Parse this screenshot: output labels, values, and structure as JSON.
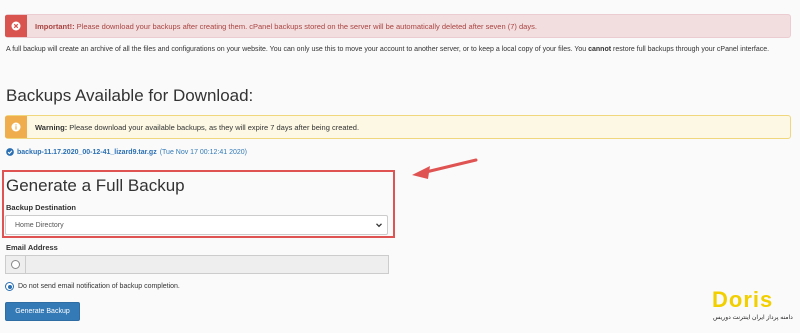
{
  "alerts": {
    "danger": {
      "icon": "close-circle-icon",
      "strong": "Important!:",
      "text": " Please download your backups after creating them. cPanel backups stored on the server will be automatically deleted after seven (7) days."
    },
    "warning": {
      "icon": "info-icon",
      "strong": "Warning:",
      "text": " Please download your available backups, as they will expire 7 days after being created."
    }
  },
  "intro": {
    "part1": "A full backup will create an archive of all the files and configurations on your website. You can only use this to move your account to another server, or to keep a local copy of your files. You ",
    "strong": "cannot",
    "part2": " restore full backups through your cPanel interface."
  },
  "backups_heading": "Backups Available for Download:",
  "backup_item": {
    "filename": "backup-11.17.2020_00-12-41_lizard9.tar.gz",
    "date": "(Tue Nov 17 00:12:41 2020)"
  },
  "generate": {
    "heading": "Generate a Full Backup",
    "destination_label": "Backup Destination",
    "destination_value": "Home Directory",
    "email_label": "Email Address",
    "email_value": "",
    "no_email_label": "Do not send email notification of backup completion.",
    "button": "Generate Backup"
  },
  "logo": {
    "word": "Doris",
    "sub": "دامنه پرداز ایران اینترنت دوریس"
  },
  "colors": {
    "accent": "#337ab7",
    "danger": "#d9534f",
    "warning": "#f0ad4e",
    "annotation_red": "#e05353",
    "logo_yellow": "#f2cf00"
  }
}
